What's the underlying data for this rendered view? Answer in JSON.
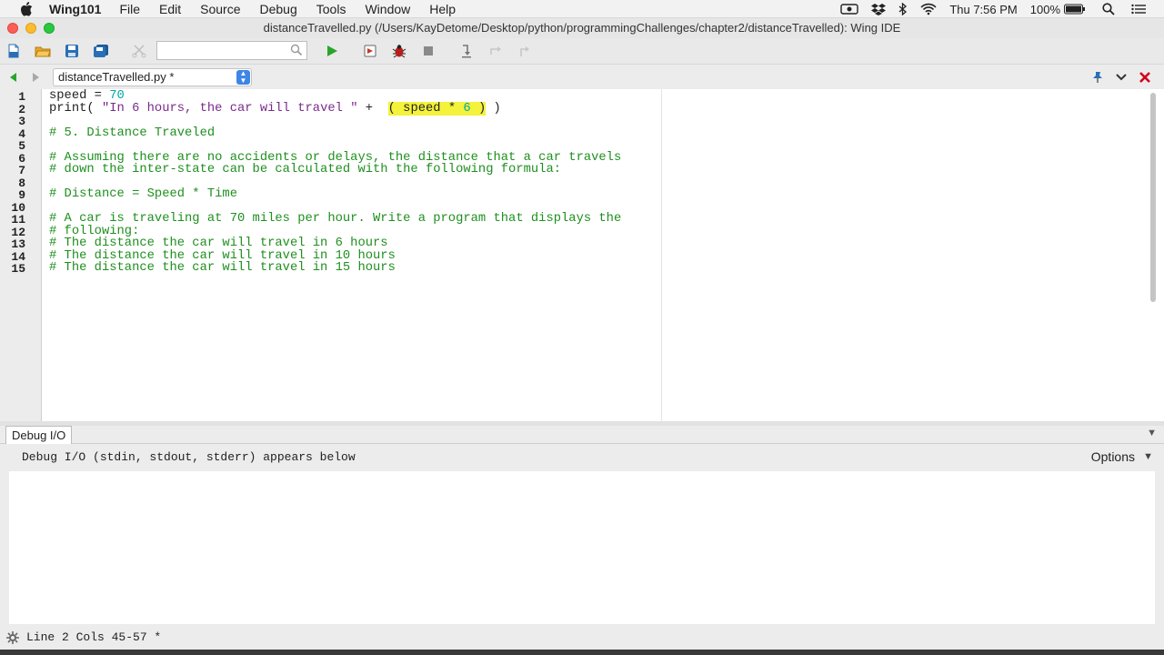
{
  "menubar": {
    "app_name": "Wing101",
    "items": [
      "File",
      "Edit",
      "Source",
      "Debug",
      "Tools",
      "Window",
      "Help"
    ],
    "clock": "Thu 7:56 PM",
    "battery": "100%"
  },
  "window": {
    "title": "distanceTravelled.py (/Users/KayDetome/Desktop/python/programmingChallenges/chapter2/distanceTravelled): Wing IDE"
  },
  "toolbar": {
    "search_value": ""
  },
  "editor": {
    "file_selector": "distanceTravelled.py *",
    "line_numbers": [
      "1",
      "2",
      "3",
      "4",
      "5",
      "6",
      "7",
      "8",
      "9",
      "10",
      "11",
      "12",
      "13",
      "14",
      "15"
    ],
    "lines": {
      "l1_kw": "speed = ",
      "l1_num": "70",
      "l2_kw": "print( ",
      "l2_str": "\"In 6 hours, the car will travel \"",
      "l2_plus": " +  ",
      "l2_hl_a": "( speed * ",
      "l2_hl_num": "6",
      "l2_hl_b": " )",
      "l2_end": " )",
      "l4": "# 5. Distance Traveled",
      "l6": "# Assuming there are no accidents or delays, the distance that a car travels",
      "l7": "# down the inter-state can be calculated with the following formula:",
      "l9": "# Distance = Speed * Time",
      "l11": "# A car is traveling at 70 miles per hour. Write a program that displays the",
      "l12": "# following:",
      "l13": "# The distance the car will travel in 6 hours",
      "l14": "# The distance the car will travel in 10 hours",
      "l15": "# The distance the car will travel in 15 hours"
    }
  },
  "debug": {
    "tab_label": "Debug I/O",
    "message": "Debug I/O (stdin, stdout, stderr) appears below",
    "options_label": "Options"
  },
  "status": {
    "text": "Line 2 Cols 45-57 *"
  },
  "colors": {
    "comment": "#1f8f1f",
    "string": "#7a2a8c",
    "number": "#00aaaa",
    "highlight": "#f4f23a",
    "close_red": "#d0021b"
  }
}
